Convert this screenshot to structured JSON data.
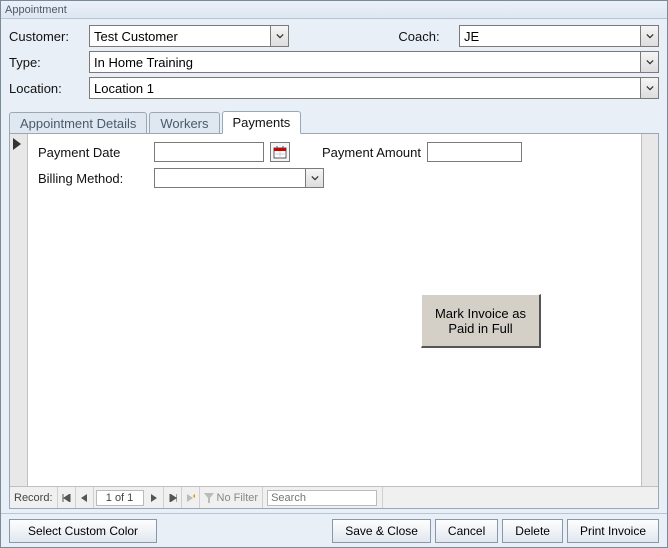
{
  "window": {
    "title": "Appointment"
  },
  "header": {
    "customer_label": "Customer:",
    "customer_value": "Test Customer",
    "coach_label": "Coach:",
    "coach_value": "JE",
    "type_label": "Type:",
    "type_value": "In Home Training",
    "location_label": "Location:",
    "location_value": "Location 1"
  },
  "tabs": {
    "details": "Appointment Details",
    "workers": "Workers",
    "payments": "Payments",
    "active": "payments"
  },
  "payments": {
    "payment_date_label": "Payment Date",
    "payment_date_value": "",
    "payment_amount_label": "Payment Amount",
    "payment_amount_value": "",
    "billing_method_label": "Billing Method:",
    "billing_method_value": "",
    "mark_button": "Mark Invoice as Paid in Full"
  },
  "nav": {
    "record_label": "Record:",
    "counter": "1 of 1",
    "no_filter": "No Filter",
    "search_placeholder": "Search"
  },
  "footer": {
    "color": "Select Custom Color",
    "save": "Save & Close",
    "cancel": "Cancel",
    "delete": "Delete",
    "print": "Print Invoice"
  }
}
